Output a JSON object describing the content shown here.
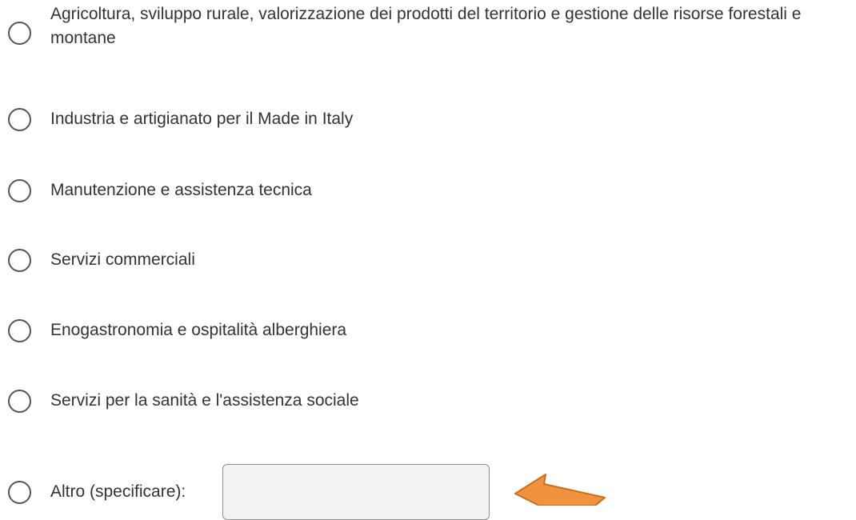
{
  "options": [
    {
      "label": "Agricoltura, sviluppo rurale, valorizzazione dei prodotti del territorio e gestione delle risorse forestali e montane",
      "selected": false
    },
    {
      "label": "Industria e artigianato per il Made in Italy",
      "selected": false
    },
    {
      "label": "Manutenzione e assistenza tecnica",
      "selected": false
    },
    {
      "label": "Servizi commerciali",
      "selected": false
    },
    {
      "label": "Enogastronomia e ospitalità alberghiera",
      "selected": false
    },
    {
      "label": "Servizi per la sanità e l'assistenza sociale",
      "selected": false
    },
    {
      "label": "Altro (specificare):",
      "selected": false
    }
  ],
  "other_input": {
    "value": "",
    "placeholder": ""
  },
  "annotation": {
    "arrow_color": "#f0923e",
    "arrow_stroke": "#c87020",
    "arrow_icon": "arrow-pointer-icon"
  }
}
